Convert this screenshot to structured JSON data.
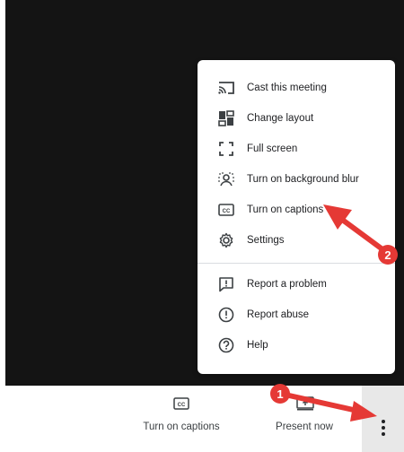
{
  "menu": {
    "items": [
      {
        "label": "Cast this meeting",
        "icon": "cast-icon"
      },
      {
        "label": "Change layout",
        "icon": "layout-icon"
      },
      {
        "label": "Full screen",
        "icon": "fullscreen-icon"
      },
      {
        "label": "Turn on background blur",
        "icon": "background-blur-icon"
      },
      {
        "label": "Turn on captions",
        "icon": "captions-icon"
      },
      {
        "label": "Settings",
        "icon": "gear-icon"
      },
      {
        "label": "Report a problem",
        "icon": "report-problem-icon"
      },
      {
        "label": "Report abuse",
        "icon": "report-abuse-icon"
      },
      {
        "label": "Help",
        "icon": "help-icon"
      }
    ]
  },
  "bottom_bar": {
    "captions_label": "Turn on captions",
    "present_label": "Present now",
    "more_options_icon": "more-vertical-icon"
  },
  "annotations": {
    "badge_1": "1",
    "badge_2": "2",
    "arrow_color": "#e53935"
  }
}
